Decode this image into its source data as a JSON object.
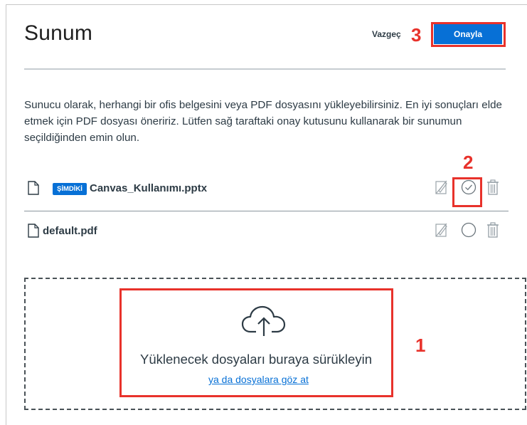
{
  "dialog": {
    "title": "Sunum",
    "cancel_label": "Vazgeç",
    "confirm_label": "Onayla",
    "description": "Sunucu olarak, herhangi bir ofis belgesini veya PDF dosyasını yükleyebilirsiniz. En iyi sonuçları elde etmek için PDF dosyası öneririz. Lütfen sağ taraftaki onay kutusunu kullanarak bir sunumun seçildiğinden emin olun."
  },
  "files": [
    {
      "badge": "ŞİMDİKİ",
      "name": "Canvas_Kullanımı.pptx",
      "selected": true
    },
    {
      "badge": "",
      "name": "default.pdf",
      "selected": false
    }
  ],
  "dropzone": {
    "text": "Yüklenecek dosyaları buraya sürükleyin",
    "browse_link": "ya da dosyalara göz at"
  },
  "annotations": [
    "1",
    "2",
    "3"
  ],
  "colors": {
    "primary": "#0770d6",
    "annotation": "#e8322b",
    "text": "#2d3b45"
  }
}
